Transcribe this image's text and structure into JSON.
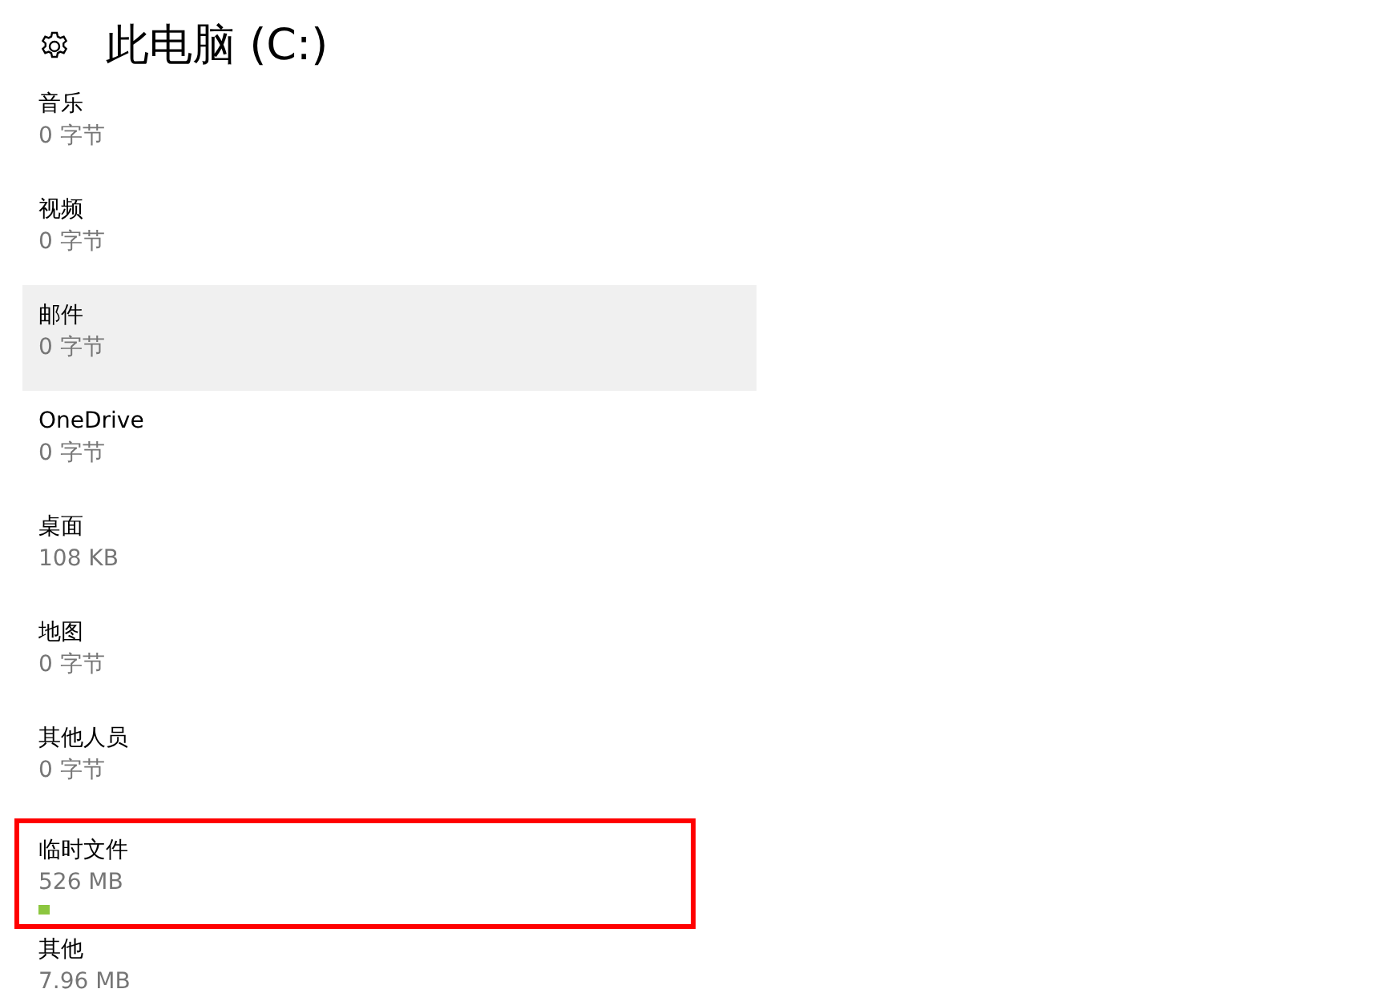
{
  "header": {
    "title": "此电脑 (C:)"
  },
  "items": [
    {
      "name": "音乐",
      "size": "0 字节",
      "highlighted": false,
      "annotated": false
    },
    {
      "name": "视频",
      "size": "0 字节",
      "highlighted": false,
      "annotated": false
    },
    {
      "name": "邮件",
      "size": "0 字节",
      "highlighted": true,
      "annotated": false
    },
    {
      "name": "OneDrive",
      "size": "0 字节",
      "highlighted": false,
      "annotated": false
    },
    {
      "name": "桌面",
      "size": "108 KB",
      "highlighted": false,
      "annotated": false
    },
    {
      "name": "地图",
      "size": "0 字节",
      "highlighted": false,
      "annotated": false
    },
    {
      "name": "其他人员",
      "size": "0 字节",
      "highlighted": false,
      "annotated": false
    },
    {
      "name": "临时文件",
      "size": "526 MB",
      "highlighted": false,
      "annotated": true,
      "level": 0.017
    },
    {
      "name": "其他",
      "size": "7.96 MB",
      "highlighted": false,
      "annotated": false
    }
  ]
}
